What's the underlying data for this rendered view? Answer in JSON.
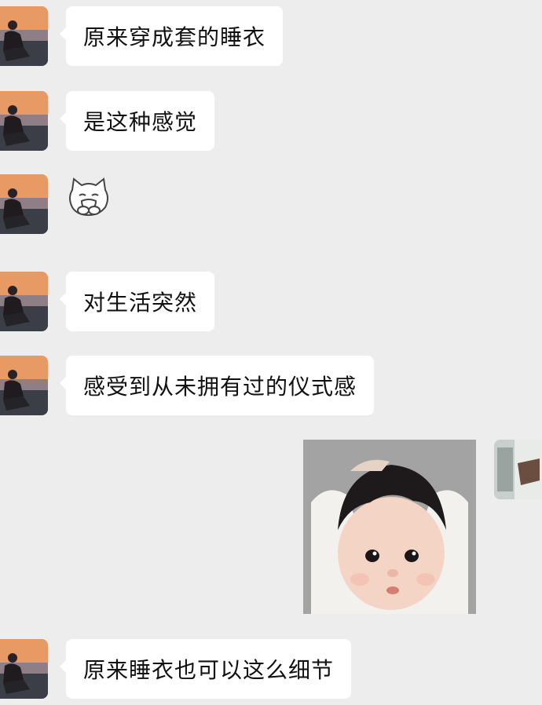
{
  "chat": {
    "messages": [
      {
        "text": "原来穿成套的睡衣"
      },
      {
        "text": "是这种感觉"
      },
      {
        "sticker": "crying-cat-sticker"
      },
      {
        "text": "对生活突然"
      },
      {
        "text": "感受到从未拥有过的仪式感"
      },
      {
        "image": "baby-photo"
      },
      {
        "text": "原来睡衣也可以这么细节"
      }
    ]
  },
  "colors": {
    "background": "#ededed",
    "incoming_bubble": "#ffffff",
    "text": "#111111"
  }
}
